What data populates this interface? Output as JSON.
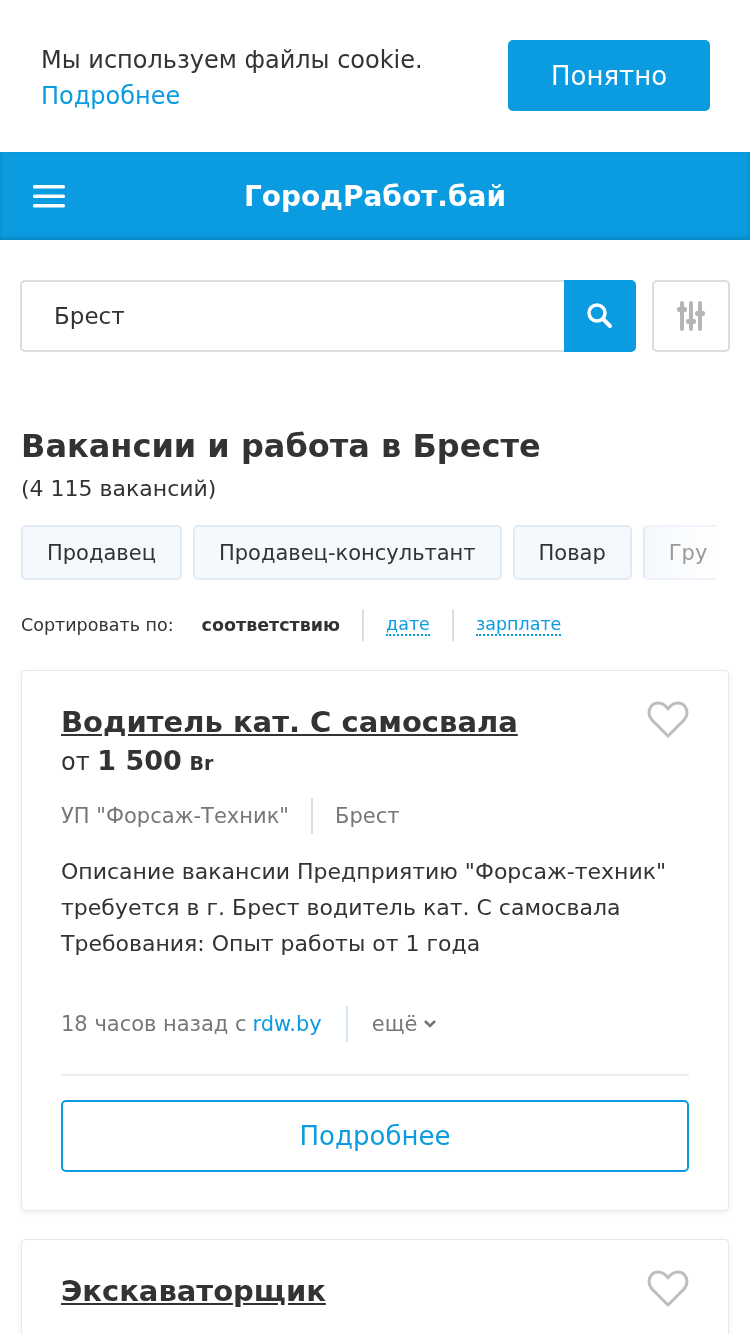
{
  "cookie_banner": {
    "text": "Мы используем файлы cookie.",
    "link": "Подробнее",
    "button": "Понятно"
  },
  "header": {
    "title": "ГородРабот.бай"
  },
  "search": {
    "value": "Брест"
  },
  "heading": {
    "title": "Вакансии и работа в Бресте",
    "count": "(4 115 вакансий)"
  },
  "chips": [
    {
      "label": "Продавец"
    },
    {
      "label": "Продавец-консультант"
    },
    {
      "label": "Повар"
    },
    {
      "label": "Гру"
    }
  ],
  "sort": {
    "label": "Сортировать по:",
    "options": [
      {
        "label": "соответствию",
        "selected": true
      },
      {
        "label": "дате",
        "selected": false
      },
      {
        "label": "зарплате",
        "selected": false
      }
    ]
  },
  "vacancies": [
    {
      "title": "Водитель кат. С самосвала",
      "salary_prefix": "от",
      "salary": "1 500",
      "currency": "Br",
      "company": "УП \"Форсаж-Техник\"",
      "city": "Брест",
      "description": "Описание вакансии Предприятию \"Форсаж-техник\" требуется в г. Брест водитель кат. С самосвала Требования: Опыт работы от 1 года",
      "time": "18 часов назад с",
      "source": "rdw.by",
      "more": "ещё",
      "button": "Подробнее",
      "saved": false
    },
    {
      "title": "Экскаваторщик",
      "saved": false
    }
  ]
}
